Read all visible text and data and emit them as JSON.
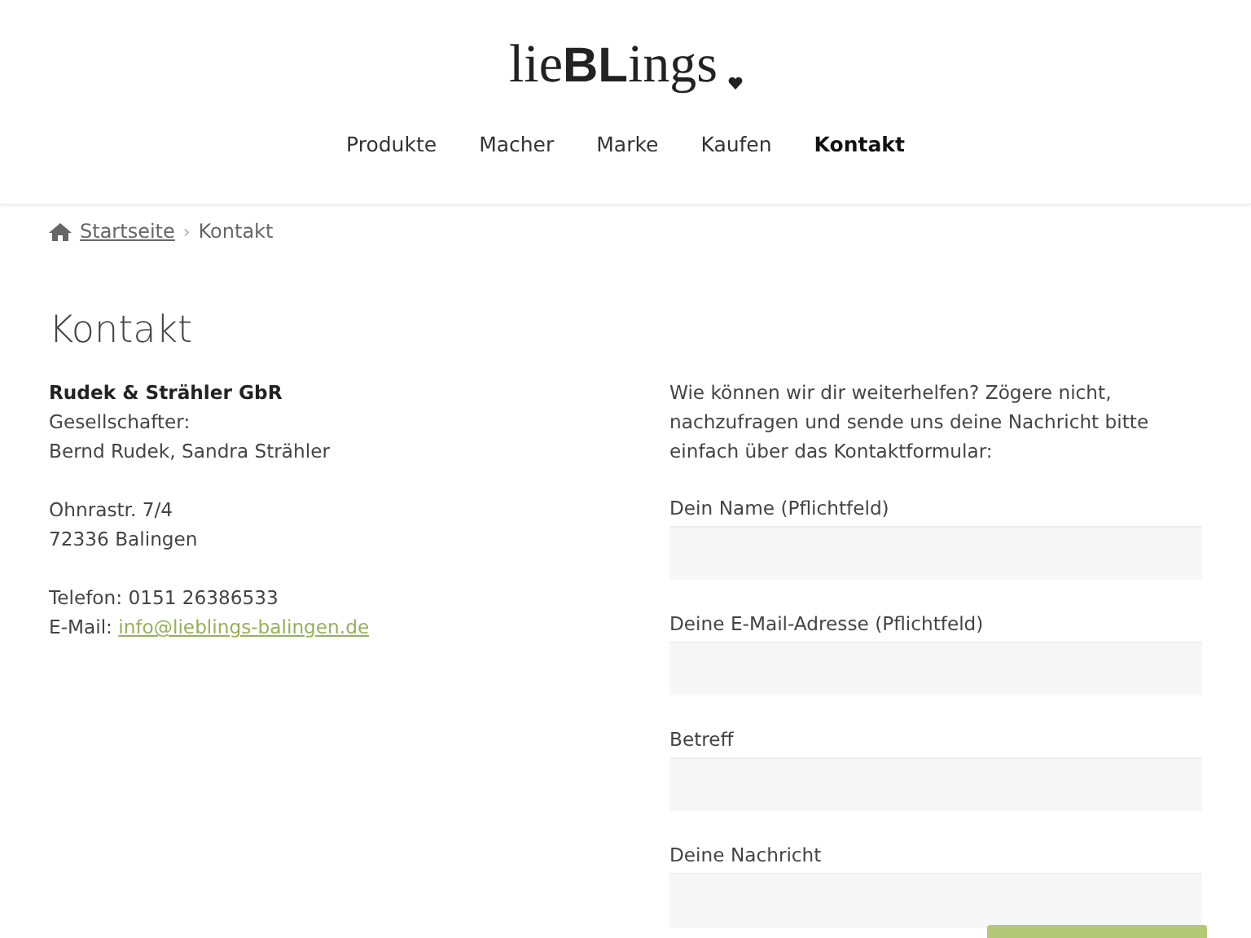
{
  "logo": {
    "text": "lie**BL**ings"
  },
  "nav": [
    {
      "label": "Produkte",
      "selected": false
    },
    {
      "label": "Macher",
      "selected": false
    },
    {
      "label": "Marke",
      "selected": false
    },
    {
      "label": "Kaufen",
      "selected": false
    },
    {
      "label": "Kontakt",
      "selected": true
    }
  ],
  "breadcrumb": {
    "home": "Startseite",
    "separator": "›",
    "current": "Kontakt"
  },
  "title": "Kontakt",
  "address": {
    "company": "Rudek & Strähler GbR",
    "lines": [
      "Gesellschafter:",
      "Bernd Rudek, Sandra Strähler"
    ],
    "street": "Ohnrastr. 7/4",
    "city": "72336 Balingen",
    "phone": "Telefon: 0151 26386533",
    "email_label": "E-Mail:",
    "email": "info@lieblings-balingen.de"
  },
  "intro": "Wie können wir dir weiterhelfen? Zögere nicht, nachzufragen und sende uns deine Nachricht bitte einfach über das Kontaktformular:",
  "fields": [
    {
      "label": "Dein Name (Pflichtfeld)",
      "kind": "input"
    },
    {
      "label": "Deine E-Mail-Adresse (Pflichtfeld)",
      "kind": "input"
    },
    {
      "label": "Betreff",
      "kind": "input"
    },
    {
      "label": "Deine Nachricht",
      "kind": "textarea"
    }
  ]
}
